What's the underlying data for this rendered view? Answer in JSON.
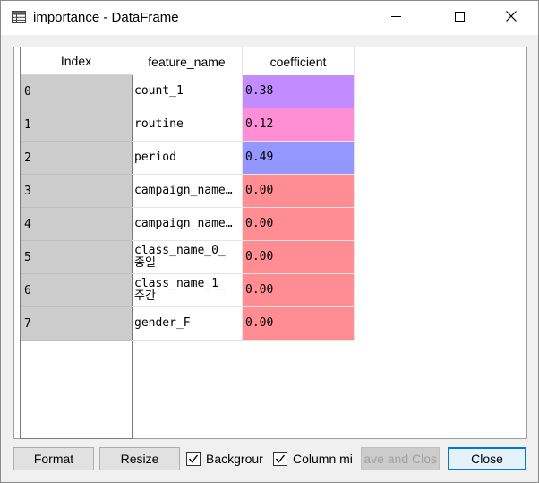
{
  "window": {
    "title": "importance - DataFrame",
    "app_icon": "table-icon",
    "controls": [
      "minimize-icon",
      "maximize-icon",
      "close-icon"
    ]
  },
  "table": {
    "index_header": "Index",
    "columns": [
      "feature_name",
      "coefficient"
    ],
    "rows": [
      {
        "index": "0",
        "feature_name": "count_1",
        "coefficient": "0.38",
        "color": "#c28bff"
      },
      {
        "index": "1",
        "feature_name": "routine",
        "coefficient": "0.12",
        "color": "#ff8ed6"
      },
      {
        "index": "2",
        "feature_name": "period",
        "coefficient": "0.49",
        "color": "#9497ff"
      },
      {
        "index": "3",
        "feature_name": "campaign_name…",
        "coefficient": "0.00",
        "color": "#ff8d92"
      },
      {
        "index": "4",
        "feature_name": "campaign_name…",
        "coefficient": "0.00",
        "color": "#ff8d92"
      },
      {
        "index": "5",
        "feature_name": "class_name_0_\n종일",
        "coefficient": "0.00",
        "color": "#ff8d92"
      },
      {
        "index": "6",
        "feature_name": "class_name_1_\n주간",
        "coefficient": "0.00",
        "color": "#ff8d92"
      },
      {
        "index": "7",
        "feature_name": "gender_F",
        "coefficient": "0.00",
        "color": "#ff8d92"
      }
    ]
  },
  "buttons": {
    "format": "Format",
    "resize": "Resize",
    "save_and_close": "ave and Clos",
    "close": "Close"
  },
  "checkboxes": {
    "background": {
      "label": "Backgrour",
      "checked": true
    },
    "column_min": {
      "label": "Column mi",
      "checked": true
    }
  }
}
